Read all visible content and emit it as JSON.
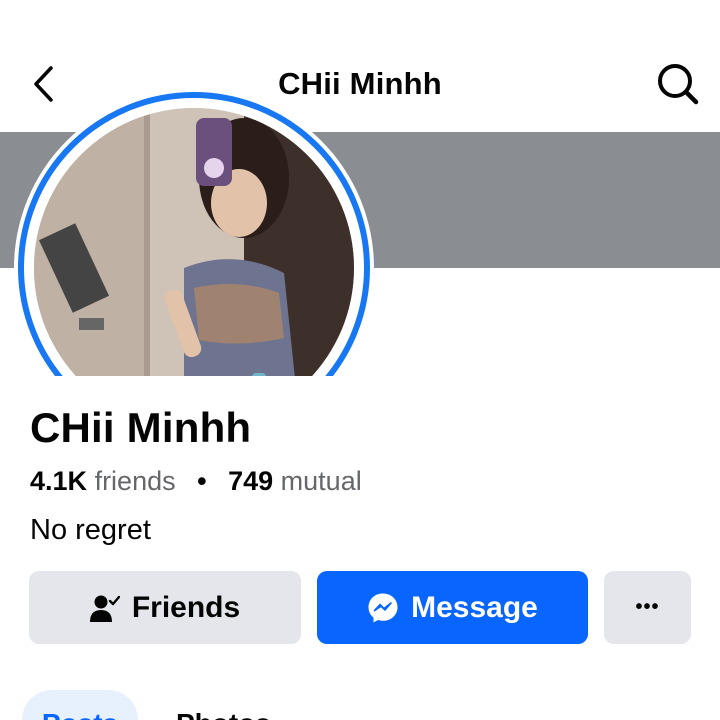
{
  "header": {
    "title": "CHii Minhh",
    "back_icon": "chevron-left-icon",
    "search_icon": "search-icon"
  },
  "profile": {
    "name": "CHii Minhh",
    "friends_count": "4.1K",
    "friends_label": "friends",
    "separator": "•",
    "mutual_count": "749",
    "mutual_label": "mutual",
    "bio": "No regret",
    "online": true
  },
  "actions": {
    "friends_label": "Friends",
    "friends_icon": "person-check-icon",
    "message_label": "Message",
    "message_icon": "messenger-icon",
    "more_label": "•••",
    "more_icon": "more-dots-icon"
  },
  "tabs": [
    {
      "label": "Posts",
      "active": true
    },
    {
      "label": "Photos",
      "active": false
    }
  ],
  "colors": {
    "accent": "#0866ff",
    "ring": "#1877f2",
    "online": "#31a24c",
    "cover": "#8a8d91",
    "button_gray": "#e4e6eb"
  }
}
